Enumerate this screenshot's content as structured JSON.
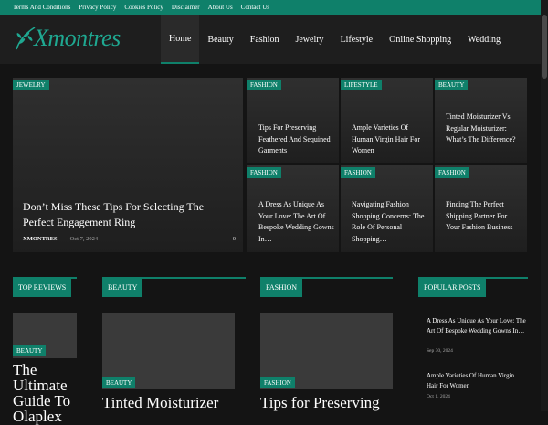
{
  "topbar": {
    "links": [
      "Terms And Conditions",
      "Privacy Policy",
      "Cookies Policy",
      "Disclaimer",
      "About Us",
      "Contact Us"
    ]
  },
  "brand": {
    "logo_text": "Xmontres"
  },
  "nav": {
    "items": [
      "Home",
      "Beauty",
      "Fashion",
      "Jewelry",
      "Lifestyle",
      "Online Shopping",
      "Wedding"
    ],
    "active": "Home"
  },
  "hero": {
    "main": {
      "tag": "JEWELRY",
      "title": "Don’t Miss These Tips For Selecting The Perfect Engagement Ring",
      "author": "XMONTRES",
      "date": "Oct 7, 2024",
      "comments": "0"
    },
    "cards": [
      {
        "tag": "FASHION",
        "title": "Tips For Preserving Feathered And Sequined Garments"
      },
      {
        "tag": "LIFESTYLE",
        "title": "Ample Varieties Of Human Virgin Hair For Women"
      },
      {
        "tag": "BEAUTY",
        "title": "Tinted Moisturizer Vs Regular Moisturizer: What’s The Difference?"
      },
      {
        "tag": "FASHION",
        "title": "A Dress As Unique As Your Love: The Art Of Bespoke Wedding Gowns In…"
      },
      {
        "tag": "FASHION",
        "title": "Navigating Fashion Shopping Concerns: The Role Of Personal Shopping…"
      },
      {
        "tag": "FASHION",
        "title": "Finding The Perfect Shipping Partner For Your Fashion Business"
      }
    ]
  },
  "sections": {
    "top_reviews": {
      "label": "TOP REVIEWS",
      "post_tag": "BEAUTY",
      "post_title": "The Ultimate Guide To Olaplex"
    },
    "beauty": {
      "label": "BEAUTY",
      "post_tag": "BEAUTY",
      "post_title": "Tinted Moisturizer"
    },
    "fashion": {
      "label": "FASHION",
      "post_tag": "FASHION",
      "post_title": "Tips for Preserving"
    },
    "popular": {
      "label": "POPULAR POSTS",
      "posts": [
        {
          "title": "A Dress As Unique As Your Love: The Art Of Bespoke Wedding Gowns In…",
          "date": "Sep 30, 2024"
        },
        {
          "title": "Ample Varieties Of Human Virgin Hair For Women",
          "date": "Oct 1, 2024"
        }
      ]
    }
  },
  "colors": {
    "accent": "#0f806a",
    "logo": "#1fa891",
    "bg": "#141414",
    "header": "#1e1e1e"
  }
}
